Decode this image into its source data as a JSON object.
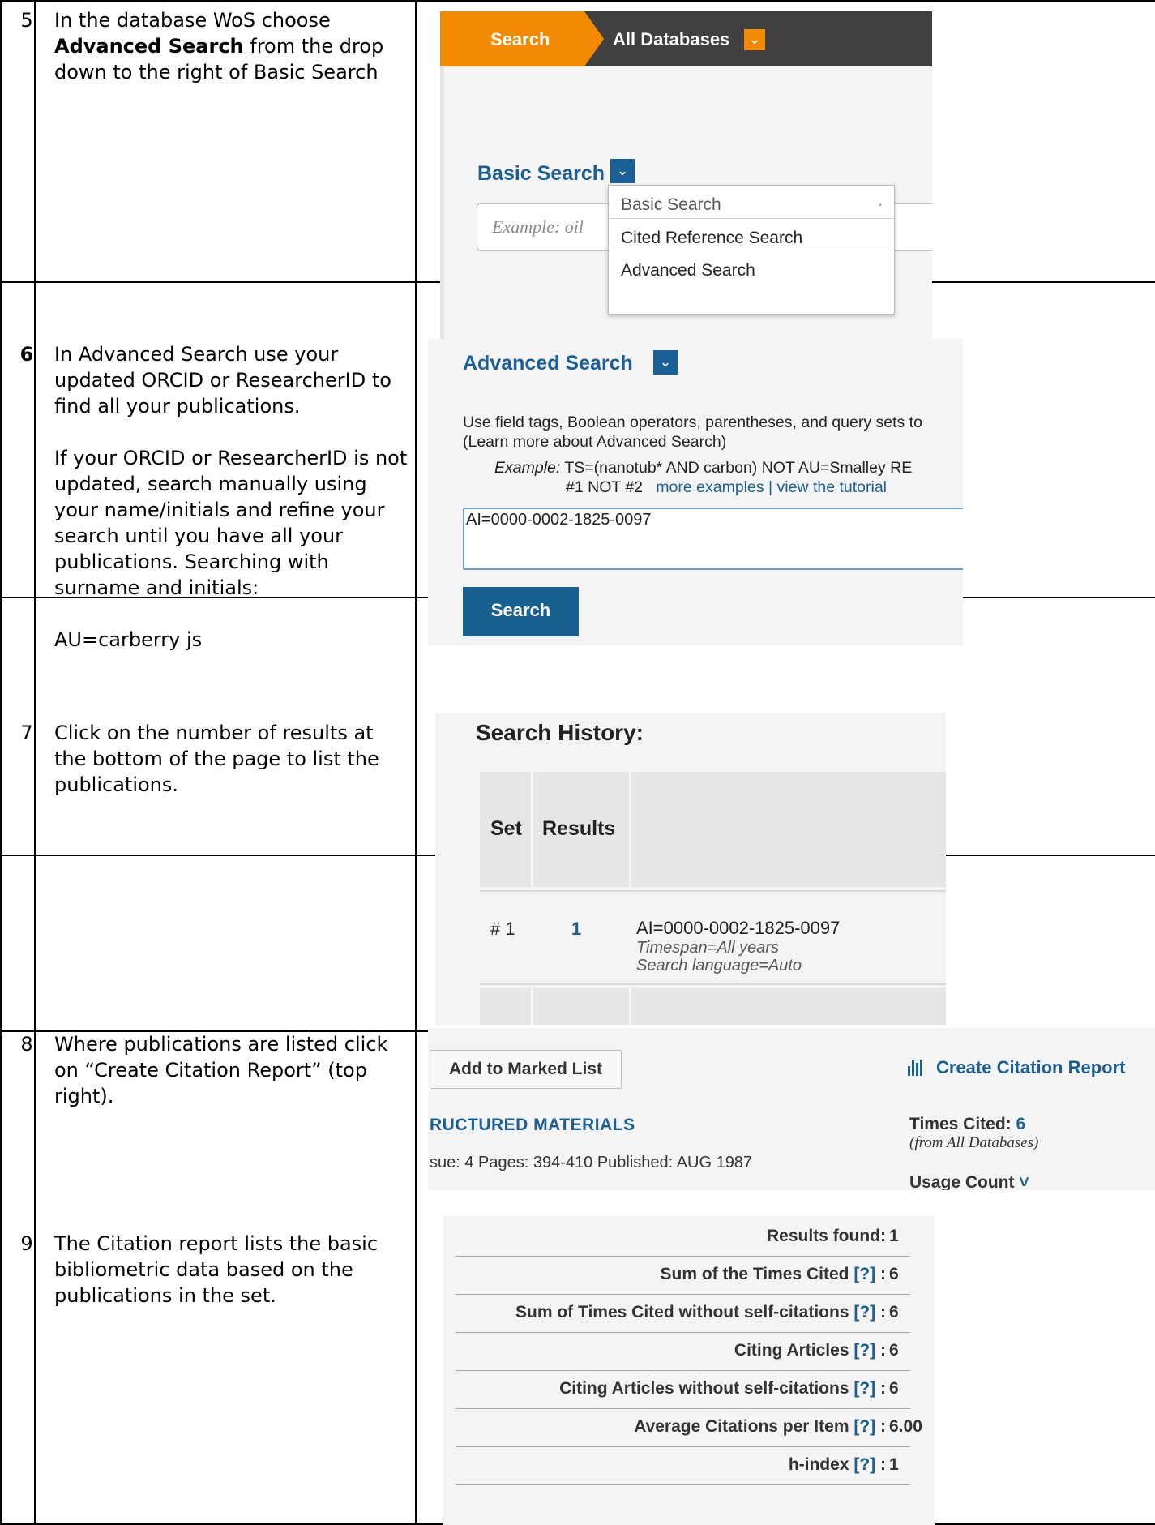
{
  "rows": [
    {
      "number": "5",
      "lines": [
        "In the database WoS choose",
        "Advanced Search",
        " from the drop",
        "down to the right of Basic Search"
      ]
    },
    {
      "number": "6",
      "paragraphs": [
        [
          "In Advanced Search use your",
          "updated ORCID or ResearcherID to",
          "find all your publications."
        ],
        [
          "If your ORCID or ResearcherID is not",
          "updated, search manually using",
          "your name/initials and refine your",
          "search until you have all your",
          "publications. Searching with",
          "surname and initials:"
        ],
        [
          "AU=carberry js"
        ]
      ]
    },
    {
      "number": "7",
      "lines": [
        "Click on the number of results at",
        "the bottom of the page to list the",
        "publications."
      ]
    },
    {
      "number": "8",
      "lines": [
        "Where publications are listed click",
        "on “Create Citation Report” (top",
        "right)."
      ]
    },
    {
      "number": "9",
      "lines": [
        "The Citation report lists the basic",
        "bibliometric data based on the",
        "publications in the set."
      ]
    }
  ],
  "wos_search_panel": {
    "tab_search": "Search",
    "database": "All Databases",
    "search_mode": "Basic Search",
    "example_placeholder": "Example: oil",
    "dropdown_options": [
      "Basic Search",
      "Cited Reference Search",
      "Advanced Search"
    ],
    "dropdown_dot": "·"
  },
  "advanced_search_panel": {
    "title": "Advanced Search",
    "help_line_1": "Use field tags, Boolean operators, parentheses, and query sets to",
    "help_line_2": "(Learn more about Advanced Search)",
    "example_label": "Example:",
    "example_query": "TS=(nanotub* AND carbon) NOT AU=Smalley RE",
    "example_line_2": "#1 NOT #2",
    "more_examples": "more examples",
    "separator": "|",
    "view_tutorial": "view the tutorial",
    "query_value": "AI=0000-0002-1825-0097",
    "search_button": "Search"
  },
  "search_history_panel": {
    "title": "Search History:",
    "col_set": "Set",
    "col_results": "Results",
    "entry": {
      "set": "# 1",
      "results": "1",
      "query": "AI=0000-0002-1825-0097",
      "timespan": "Timespan=All years",
      "language": "Search language=Auto"
    }
  },
  "results_panel": {
    "add_to_marked_list": "Add to Marked List",
    "create_citation_report": "Create Citation Report",
    "source_title": "RUCTURED MATERIALS",
    "pub_info": "sue: 4   Pages: 394-410   Published: AUG 1987",
    "times_cited_label": "Times Cited:",
    "times_cited_value": "6",
    "from_databases": "(from All Databases)",
    "usage_count": "Usage Count",
    "usage_chevron": "˅"
  },
  "citation_report_panel": {
    "metrics": [
      {
        "label": "Results found:",
        "help": "",
        "value": "1"
      },
      {
        "label": "Sum of the Times Cited",
        "help": "[?]",
        "value": "6"
      },
      {
        "label": "Sum of Times Cited without self-citations",
        "help": "[?]",
        "value": "6"
      },
      {
        "label": "Citing Articles",
        "help": "[?]",
        "value": "6"
      },
      {
        "label": "Citing Articles without self-citations",
        "help": "[?]",
        "value": "6"
      },
      {
        "label": "Average Citations per Item",
        "help": "[?]",
        "value": "6.00"
      },
      {
        "label": "h-index",
        "help": "[?]",
        "value": "1"
      }
    ]
  }
}
